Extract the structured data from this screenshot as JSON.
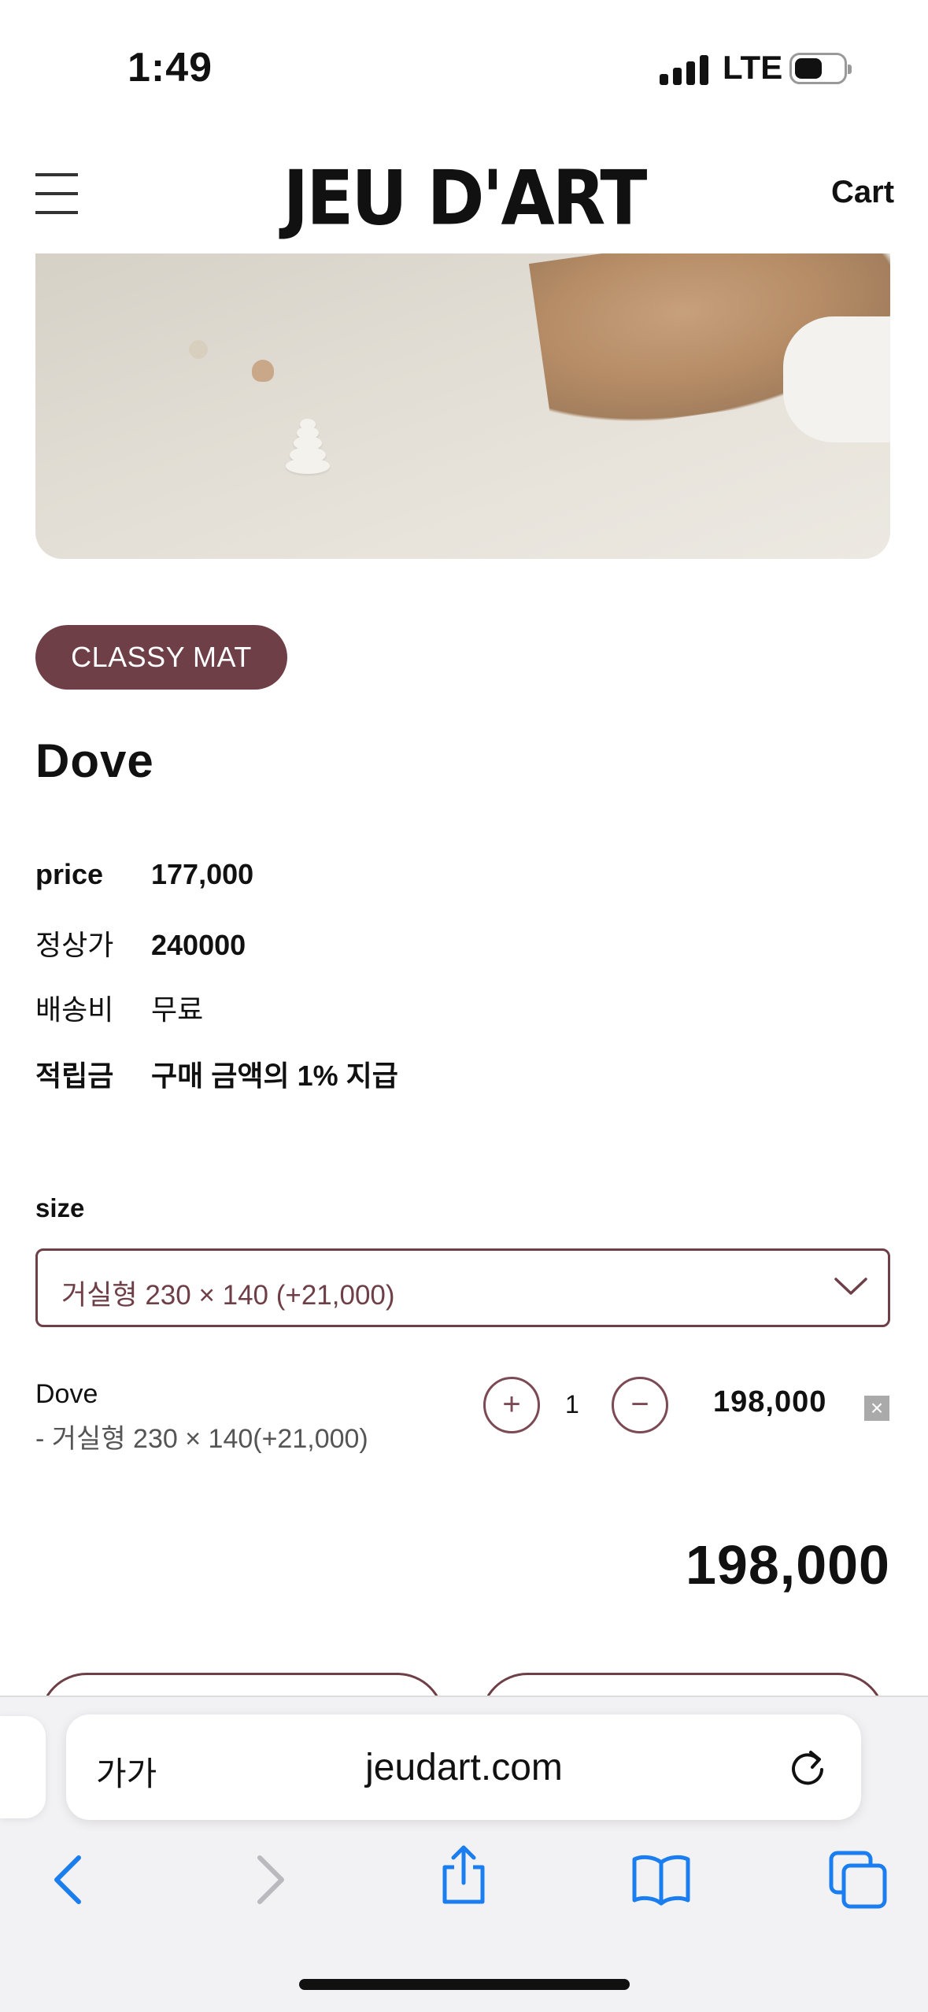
{
  "status_bar": {
    "time": "1:49",
    "network": "LTE"
  },
  "header": {
    "brand": "JEU D'ART",
    "cart_label": "Cart"
  },
  "product": {
    "category_badge": "CLASSY MAT",
    "title": "Dove",
    "info": [
      {
        "label": "price",
        "value": "177,000"
      },
      {
        "label": "정상가",
        "value": "240000"
      },
      {
        "label": "배송비",
        "value": "무료"
      },
      {
        "label": "적립금",
        "value": "구매 금액의 1% 지급"
      }
    ]
  },
  "options": {
    "size_label": "size",
    "selected_size": "거실형 230 × 140 (+21,000)",
    "selected_item": {
      "name": "Dove",
      "detail": "- 거실형 230 × 140(+21,000)",
      "plus_label": "+",
      "minus_label": "−",
      "quantity": "1",
      "price": "198,000",
      "remove_label": "×"
    },
    "total": "198,000"
  },
  "browser": {
    "text_size_label": "가가",
    "url": "jeudart.com"
  },
  "colors": {
    "accent": "#6f3f48",
    "ios_blue": "#1a7ef0"
  }
}
